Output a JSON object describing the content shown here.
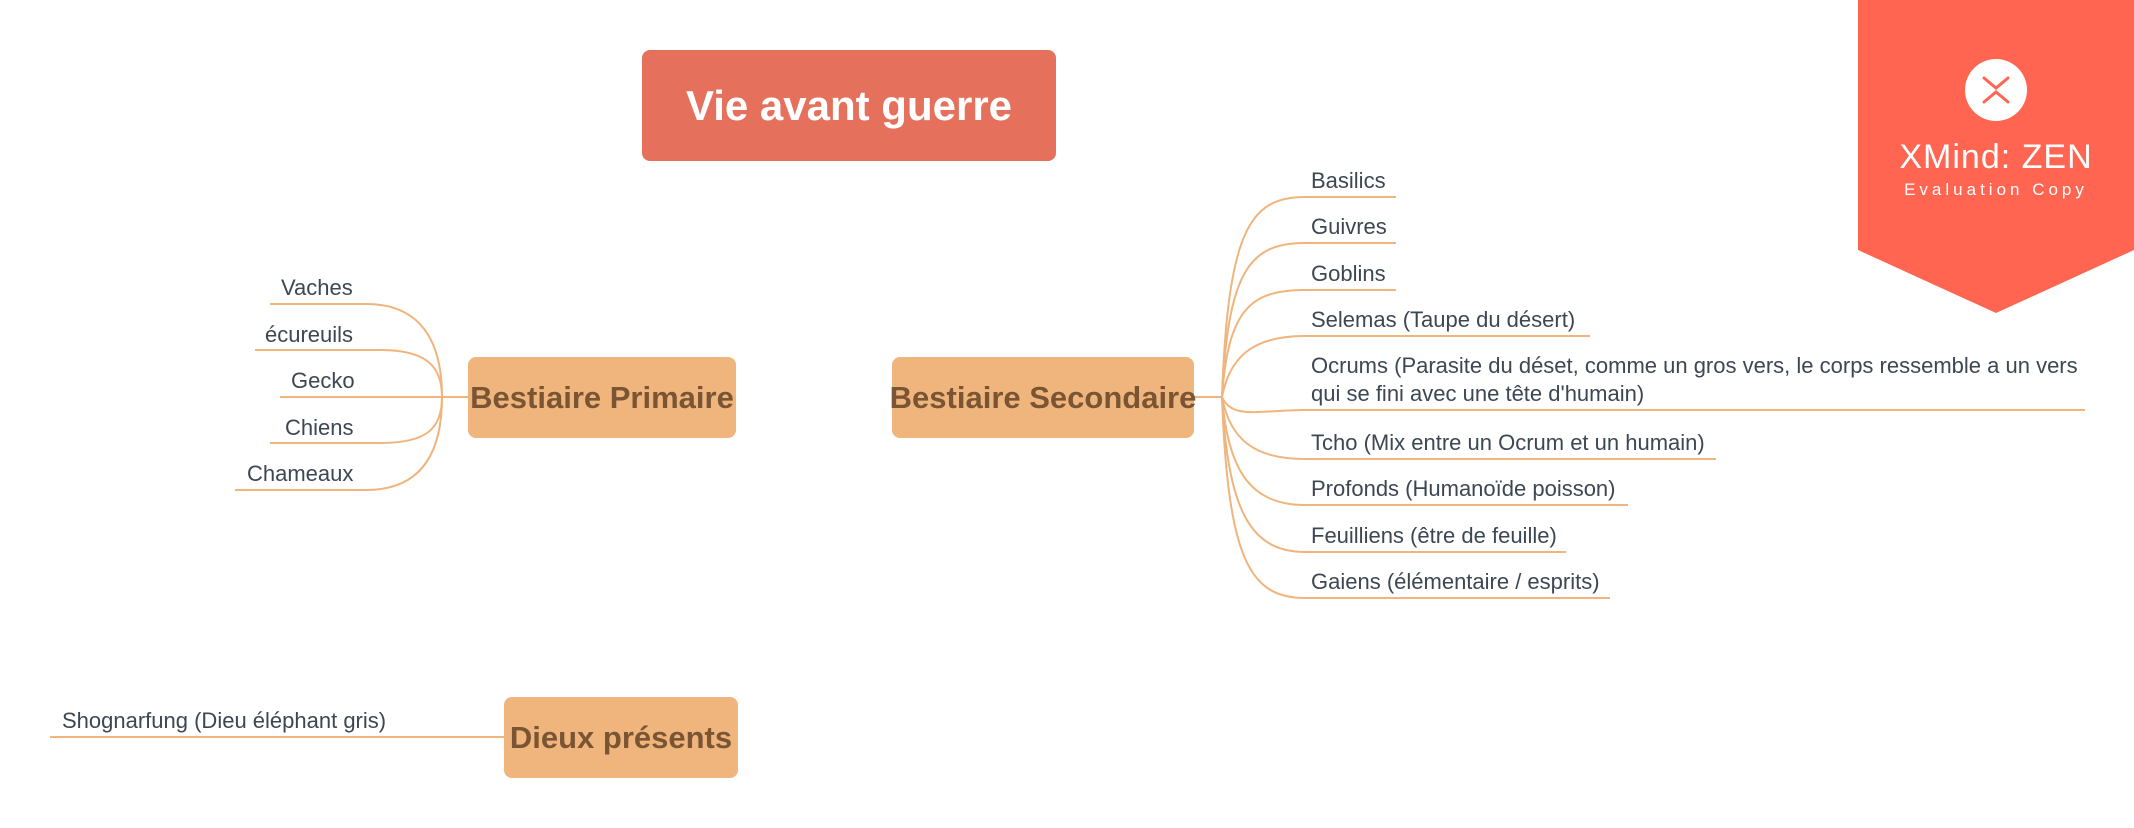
{
  "central_topic": "Vie avant guerre",
  "primaire": {
    "label": "Bestiaire Primaire",
    "items": [
      "Vaches",
      "écureuils",
      "Gecko",
      "Chiens",
      "Chameaux"
    ]
  },
  "secondaire": {
    "label": "Bestiaire Secondaire",
    "items": [
      "Basilics",
      "Guivres",
      "Goblins",
      "Selemas (Taupe du désert)",
      "Ocrums (Parasite du déset, comme un gros vers, le corps ressemble a un vers",
      "qui se fini avec une tête d'humain)",
      "Tcho (Mix entre un Ocrum et un humain)",
      "Profonds (Humanoïde poisson)",
      "Feuilliens (être de feuille)",
      "Gaiens (élémentaire / esprits)"
    ]
  },
  "dieux": {
    "label": "Dieux présents",
    "items": [
      "Shognarfung (Dieu éléphant gris)"
    ]
  },
  "watermark": {
    "brand": "XMind: ZEN",
    "subtitle": "Evaluation Copy",
    "logo_icon": "xmind-logo-icon"
  },
  "colors": {
    "central": "#e5705c",
    "main_topic": "#f0b47d",
    "main_text": "#7a5534",
    "connector": "#f0b47d",
    "leaf_text": "#3d4753",
    "badge": "#ff6550"
  }
}
